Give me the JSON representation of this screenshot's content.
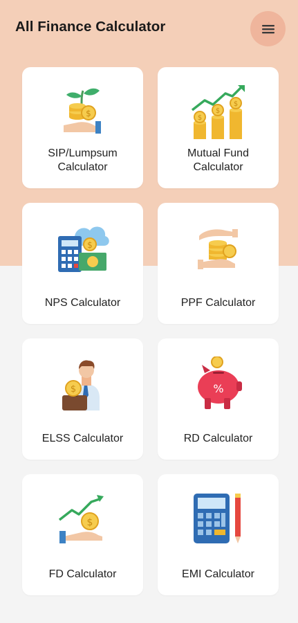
{
  "header": {
    "title": "All Finance Calculator",
    "menu_icon": "hamburger-menu-icon"
  },
  "colors": {
    "top_background": "#f4cfb8",
    "menu_button": "#efb59c",
    "page_background": "#f4f4f4",
    "card": "#ffffff"
  },
  "cards": [
    {
      "label": "SIP/Lumpsum\nCalculator",
      "icon": "plant-coins-hand-icon"
    },
    {
      "label": "Mutual Fund\nCalculator",
      "icon": "rising-coins-chart-icon"
    },
    {
      "label": "NPS Calculator",
      "icon": "calculator-cloud-cash-icon"
    },
    {
      "label": "PPF Calculator",
      "icon": "hands-coins-icon"
    },
    {
      "label": "ELSS Calculator",
      "icon": "businessman-coins-icon"
    },
    {
      "label": "RD Calculator",
      "icon": "piggy-bank-icon"
    },
    {
      "label": "FD Calculator",
      "icon": "hand-coin-growth-icon"
    },
    {
      "label": "EMI Calculator",
      "icon": "calculator-pencil-icon"
    }
  ]
}
